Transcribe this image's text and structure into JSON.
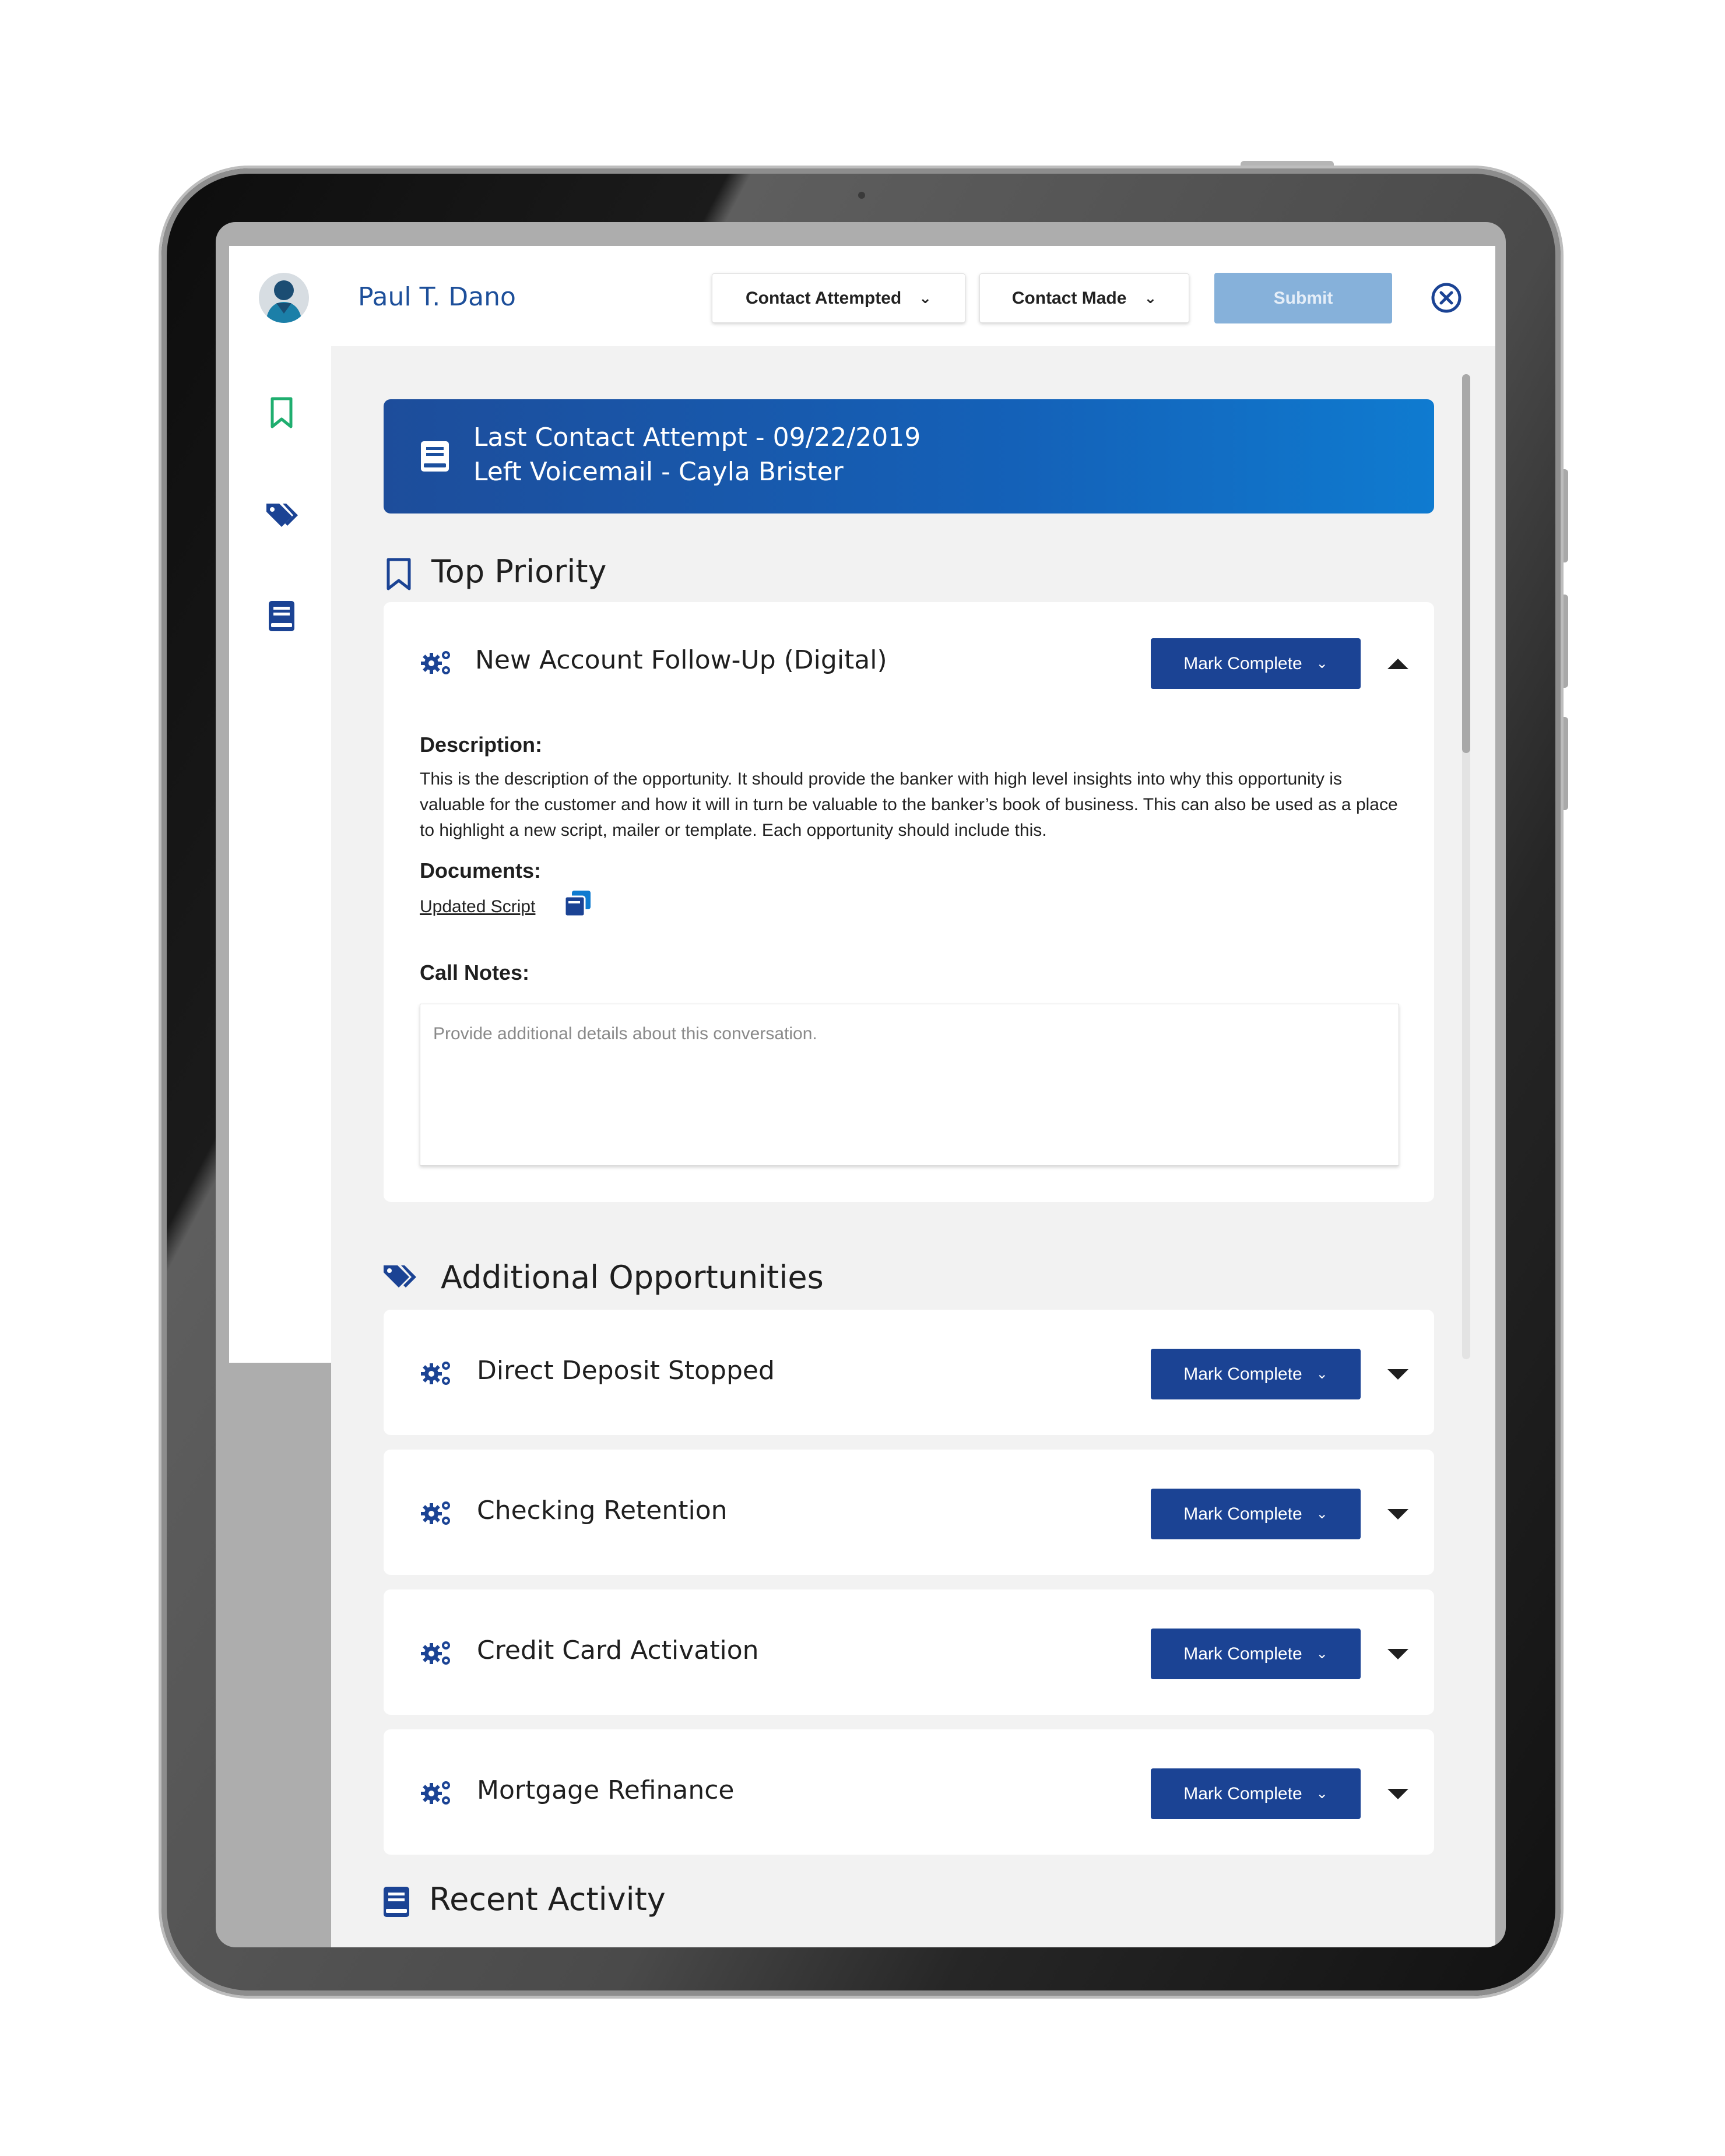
{
  "header": {
    "user_name": "Paul T. Dano",
    "contact_attempted": "Contact Attempted",
    "contact_made": "Contact Made",
    "submit": "Submit",
    "chevron": "⌄"
  },
  "banner": {
    "line1": "Last Contact Attempt - 09/22/2019",
    "line2": "Left Voicemail - Cayla Brister"
  },
  "sections": {
    "top_priority": "Top Priority",
    "additional": "Additional Opportunities",
    "recent": "Recent Activity"
  },
  "top_card": {
    "title": "New Account Follow-Up (Digital)",
    "mark_complete": "Mark Complete",
    "description_label": "Description:",
    "description": "This is the description of the opportunity. It should provide the banker with high level insights into why this opportunity is valuable for the customer and how it will in turn be valuable to the banker’s book of business. This can also be used as a place to highlight a new script, mailer or template. Each opportunity should include this.",
    "documents_label": "Documents:",
    "document_link": "Updated Script",
    "call_notes_label": "Call Notes:",
    "call_notes_placeholder": "Provide additional details about this conversation."
  },
  "opportunities": [
    {
      "title": "Direct Deposit Stopped",
      "mark_complete": "Mark Complete"
    },
    {
      "title": "Checking Retention",
      "mark_complete": "Mark Complete"
    },
    {
      "title": "Credit Card Activation",
      "mark_complete": "Mark Complete"
    },
    {
      "title": "Mortgage Refinance",
      "mark_complete": "Mark Complete"
    }
  ],
  "icons": {
    "avatar": "user-silhouette-icon",
    "close": "close-circle-icon",
    "bookmark": "bookmark-icon",
    "tags": "tags-icon",
    "book": "book-icon",
    "gears": "gears-icon",
    "copy": "copy-icon",
    "expand": "caret-down-icon",
    "collapse": "caret-up-icon"
  },
  "colors": {
    "brand_blue": "#1b4394",
    "accent_green": "#1fae6f",
    "submit_disabled": "#86b1da"
  }
}
